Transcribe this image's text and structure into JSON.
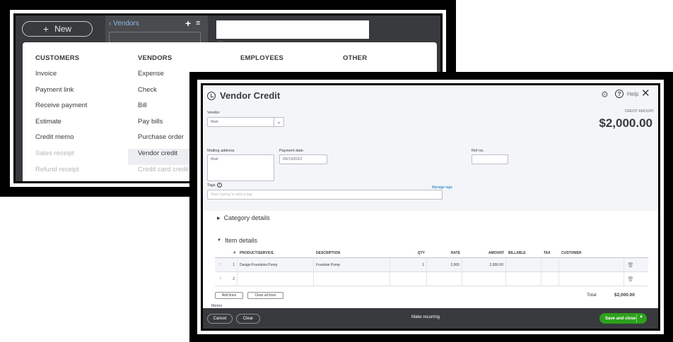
{
  "menu_screen": {
    "new_button_label": "New",
    "vendors_link": "Vendors",
    "address_peek": "…",
    "columns": {
      "customers": {
        "header": "CUSTOMERS",
        "items": [
          "Invoice",
          "Payment link",
          "Receive payment",
          "Estimate",
          "Credit memo",
          "Sales receipt",
          "Refund receipt"
        ]
      },
      "vendors": {
        "header": "VENDORS",
        "items": [
          "Expense",
          "Check",
          "Bill",
          "Pay bills",
          "Purchase order",
          "Vendor credit",
          "Credit card credit"
        ]
      },
      "employees": {
        "header": "EMPLOYEES"
      },
      "other": {
        "header": "OTHER"
      }
    }
  },
  "vendor_credit": {
    "title": "Vendor Credit",
    "help_label": "Help",
    "vendor_label": "Vendor",
    "vendor_value": "Mail",
    "credit_amount_label": "CREDIT AMOUNT",
    "credit_amount": "$2,000.00",
    "mailing_address_label": "Mailing address",
    "mailing_address_value": "Mail",
    "payment_date_label": "Payment date",
    "payment_date_value": "09/13/2022",
    "ref_no_label": "Ref no.",
    "tags_label": "Tags",
    "manage_tags": "Manage tags",
    "tags_placeholder": "Start typing to add a tag",
    "category_details": "Category details",
    "item_details": "Item details",
    "table_headers": [
      "#",
      "PRODUCT/SERVICE",
      "DESCRIPTION",
      "QTY",
      "RATE",
      "AMOUNT",
      "BILLABLE",
      "TAX",
      "CUSTOMER"
    ],
    "rows": [
      {
        "num": "1",
        "product": "Design:Fountains:Pump",
        "description": "Fountain Pump",
        "qty": "1",
        "rate": "2,000",
        "amount": "2,000.00"
      },
      {
        "num": "2",
        "product": "",
        "description": "",
        "qty": "",
        "rate": "",
        "amount": ""
      }
    ],
    "add_lines": "Add lines",
    "clear_all_lines": "Clear all lines",
    "total_label": "Total",
    "total_value": "$2,000.00",
    "memo_label": "Memo",
    "footer": {
      "cancel": "Cancel",
      "clear": "Clear",
      "make_recurring": "Make recurring",
      "save_and_close": "Save and close"
    }
  },
  "colors": {
    "qbo_dark": "#393a3d",
    "qbo_green": "#2ca01c",
    "qbo_link_blue": "#0077c5",
    "frame_black": "#000000"
  }
}
